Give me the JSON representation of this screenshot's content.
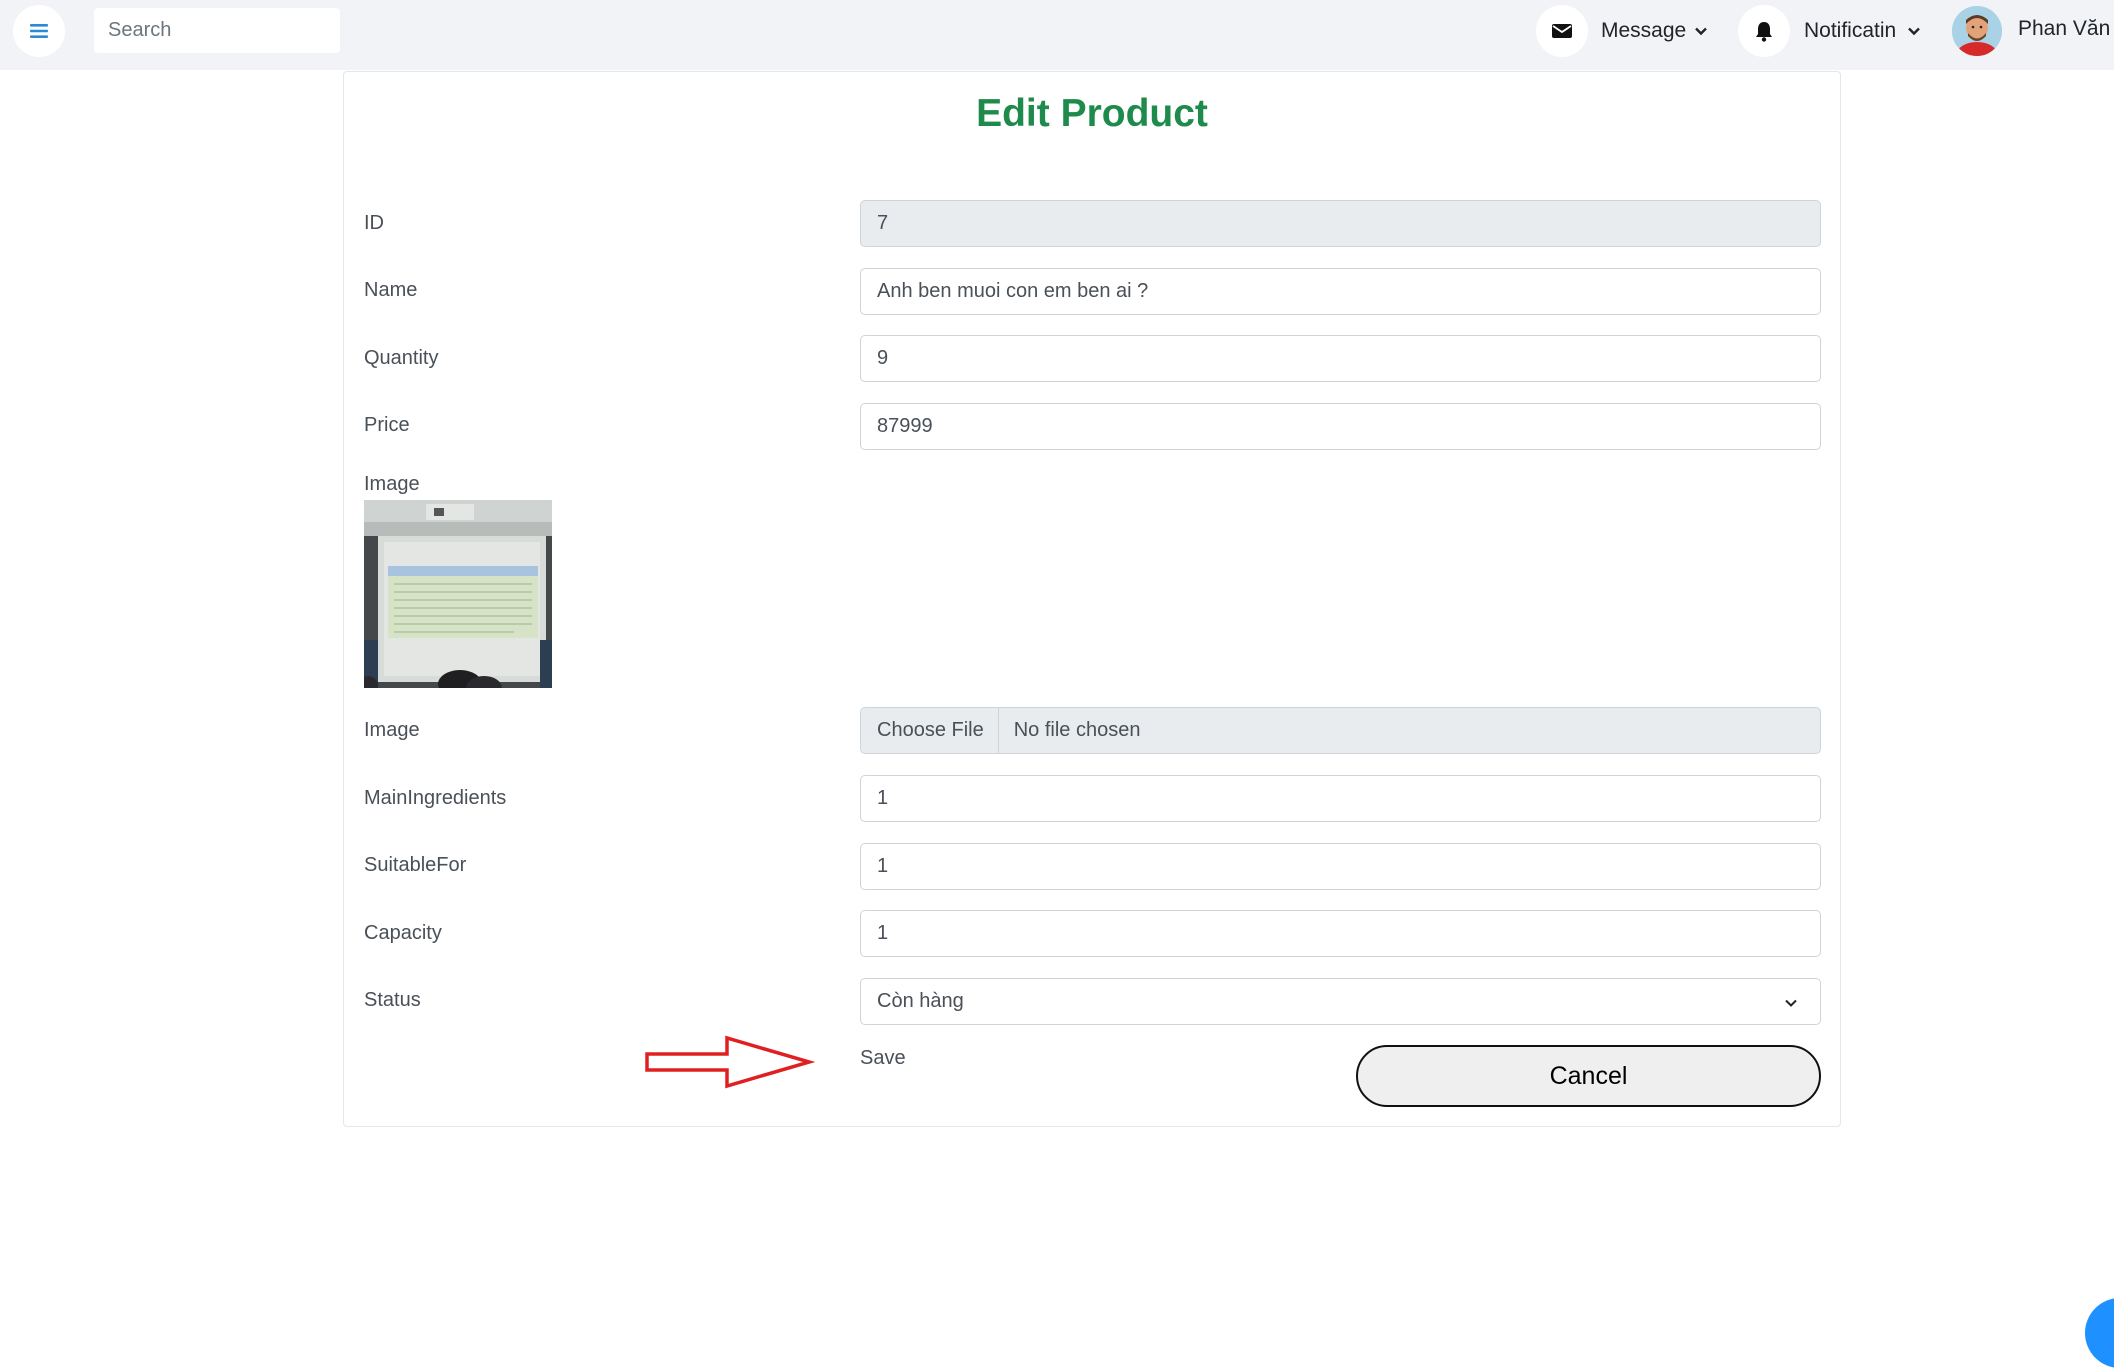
{
  "header": {
    "search_placeholder": "Search",
    "message_label": "Message",
    "notification_label": "Notificatin",
    "user_name": "Phan Văn T"
  },
  "page": {
    "title": "Edit Product"
  },
  "form": {
    "fields": [
      {
        "label": "ID",
        "value": "7",
        "readonly": true
      },
      {
        "label": "Name",
        "value": "Anh ben muoi con em ben ai ?"
      },
      {
        "label": "Quantity",
        "value": "9"
      },
      {
        "label": "Price",
        "value": "87999"
      }
    ],
    "image_preview_label": "Image",
    "image_upload": {
      "label": "Image",
      "button": "Choose File",
      "file_text": "No file chosen"
    },
    "extra_fields": [
      {
        "label": "MainIngredients",
        "value": "1"
      },
      {
        "label": "SuitableFor",
        "value": "1"
      },
      {
        "label": "Capacity",
        "value": "1"
      }
    ],
    "status": {
      "label": "Status",
      "selected": "Còn hàng"
    },
    "save_label": "Save",
    "cancel_label": "Cancel"
  },
  "colors": {
    "title_green": "#1e8a4c",
    "menu_blue": "#2a8ad6",
    "annotation_red": "#e02020",
    "topbar_bg": "#f1f3f6"
  },
  "icons": [
    "menu-icon",
    "envelope-icon",
    "bell-icon",
    "chevron-down-icon",
    "avatar",
    "red-arrow-annotation"
  ]
}
